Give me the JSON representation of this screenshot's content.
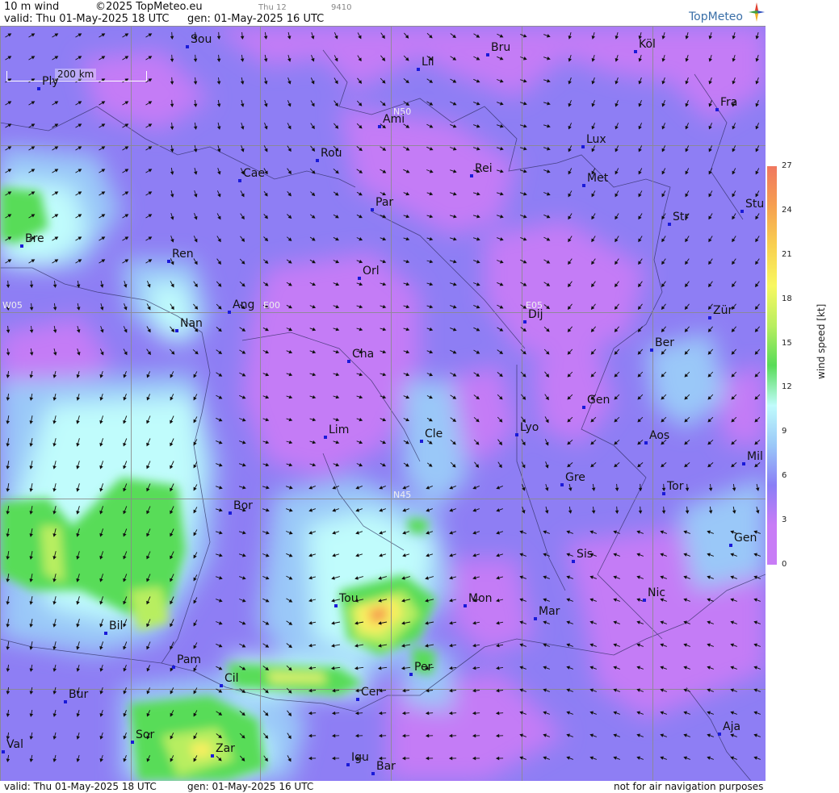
{
  "header": {
    "product": "10 m wind",
    "copyright": "©2025 TopMeteo.eu",
    "run_label": "Thu 12",
    "run_code": "9410",
    "valid": "valid:  Thu  01-May-2025  18 UTC",
    "gen": "gen: 01-May-2025 16 UTC",
    "brand": "TopMeteo"
  },
  "footer": {
    "valid": "valid:  Thu  01-May-2025  18 UTC",
    "gen": "gen: 01-May-2025 16 UTC",
    "disclaimer": "not for air navigation purposes"
  },
  "scale_bar": "200 km",
  "colorbar": {
    "title": "wind speed [kt]",
    "ticks": [
      "27",
      "24",
      "21",
      "18",
      "15",
      "12",
      "9",
      "6",
      "3",
      "0"
    ],
    "colors": [
      "#f07860",
      "#f6a050",
      "#f8d050",
      "#f8f860",
      "#b8ee60",
      "#58dc58",
      "#c0fcfc",
      "#9ac8f8",
      "#8a7ef6",
      "#c87cf6"
    ]
  },
  "grid_labels": [
    "N50",
    "N45",
    "W05",
    "E00",
    "E05"
  ],
  "cities": [
    "Sou",
    "Bru",
    "Köl",
    "Lil",
    "Ply",
    "Fra",
    "Ami",
    "Lux",
    "Rou",
    "Cae",
    "Rei",
    "Met",
    "Par",
    "Stu",
    "Str",
    "Bre",
    "Ren",
    "Orl",
    "Ang",
    "Dij",
    "Zür",
    "Nan",
    "Ber",
    "Cha",
    "Gen",
    "Lim",
    "Cle",
    "Lyo",
    "Aos",
    "Mil",
    "Gre",
    "Tor",
    "Bor",
    "Gen",
    "Sis",
    "Nic",
    "Tou",
    "Mon",
    "Mar",
    "Bil",
    "Pam",
    "Per",
    "Cil",
    "Cer",
    "Bur",
    "Sor",
    "Aja",
    "Val",
    "Zar",
    "Igu",
    "Bar"
  ]
}
